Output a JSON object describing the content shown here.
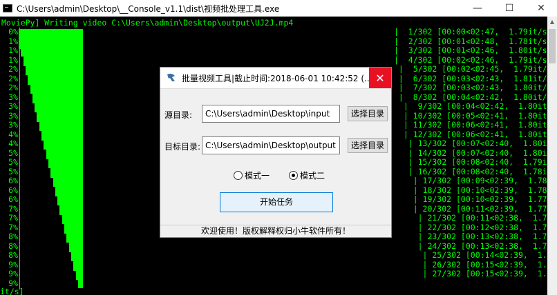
{
  "console_window": {
    "title": "C:\\Users\\admin\\Desktop\\__Console_v1.1\\dist\\视频批处理工具.exe",
    "minimize": "—",
    "maximize": "☐",
    "close": "✕"
  },
  "console": {
    "header": "MoviePy] Writing video C:\\Users\\admin\\Desktop\\output\\UJ2J.mp4",
    "footer": "it/s]",
    "percent_lines": [
      "0%",
      "1%",
      "1%",
      "1%",
      "2%",
      "2%",
      "2%",
      "3%",
      "3%",
      "3%",
      "3%",
      "4%",
      "4%",
      "5%",
      "5%",
      "5%",
      "6%",
      "6%",
      "6%",
      "7%",
      "7%",
      "7%",
      "8%",
      "8%",
      "8%",
      "9%",
      "9%",
      "9%"
    ],
    "bar_heights": [
      29,
      40,
      54,
      67,
      81,
      94,
      108,
      121,
      135,
      148,
      162,
      175,
      189,
      202,
      216,
      229,
      243,
      256,
      270,
      283,
      297,
      310,
      324,
      337,
      351,
      364,
      378,
      392
    ],
    "progress_lines": [
      "|  1/302 [00:00<02:47,  1.79it/s]",
      "|  2/302 [00:01<02:48,  1.78it/s]",
      "|  3/302 [00:01<02:46,  1.80it/s]",
      "|  4/302 [00:02<02:46,  1.79it/s]",
      " |  5/302 [00:02<02:45,  1.79it/s",
      " |  6/302 [00:03<02:43,  1.81it/s",
      " |  7/302 [00:03<02:43,  1.80it/s",
      " |  8/302 [00:04<02:42,  1.80it/s",
      "  |  9/302 [00:04<02:42,  1.80it/",
      "  | 10/302 [00:05<02:41,  1.80it/",
      "  | 11/302 [00:06<02:41,  1.80it/",
      "  | 12/302 [00:06<02:41,  1.80it/",
      "   | 13/302 [00:07<02:40,  1.80it",
      "   | 14/302 [00:07<02:40,  1.80it",
      "   | 15/302 [00:08<02:40,  1.79it",
      "   | 16/302 [00:08<02:40,  1.78it",
      "    | 17/302 [00:09<02:39,  1.78i",
      "    | 18/302 [00:10<02:39,  1.78i",
      "    | 19/302 [00:10<02:39,  1.77i",
      "    | 20/302 [00:11<02:39,  1.77i",
      "     | 21/302 [00:11<02:38,  1.77",
      "     | 22/302 [00:12<02:38,  1.76",
      "     | 23/302 [00:13<02:38,  1.76",
      "     | 24/302 [00:13<02:38,  1.75",
      "      | 25/302 [00:14<02:39,  1.7",
      "      | 26/302 [00:15<02:39,  1.7",
      "      | 27/302 [00:15<02:39,  1.7"
    ]
  },
  "dialog": {
    "title": "批量视频工具|截止时间:2018-06-01 10:42:52 (...",
    "close": "✕",
    "source_label": "源目录:",
    "source_value": "C:\\Users\\admin\\Desktop\\input",
    "source_button": "选择目录",
    "target_label": "目标目录:",
    "target_value": "C:\\Users\\admin\\Desktop\\output",
    "target_button": "选择目录",
    "mode1": "模式一",
    "mode2": "模式二",
    "selected_mode": "模式二",
    "start_button": "开始任务",
    "status": "欢迎使用！版权解释权归小牛软件所有！"
  },
  "colors": {
    "console_text": "#00ff00",
    "console_bg": "#000000",
    "close_red": "#e81123",
    "accent_blue": "#0078d7"
  }
}
